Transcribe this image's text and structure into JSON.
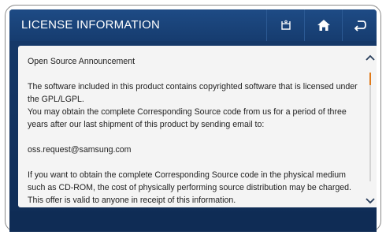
{
  "header": {
    "title": "LICENSE INFORMATION"
  },
  "icons": {
    "first": "washer-tub-icon",
    "home": "home-icon",
    "back": "back-icon",
    "scroll_up": "chevron-up-icon",
    "scroll_down": "chevron-down-icon"
  },
  "content": {
    "heading": "Open Source Announcement",
    "para1": "The software included in this product contains copyrighted software that is licensed under the GPL/LGPL.",
    "para2": "You may obtain the complete Corresponding Source code from us for a period of three years after our last shipment of this product by sending email to:",
    "email": "oss.request@samsung.com",
    "para3": "If you want to obtain the complete Corresponding Source code in the physical medium such as CD-ROM, the cost of physically performing source distribution may be charged.",
    "para4": "This offer is valid to anyone in receipt of this information."
  },
  "colors": {
    "header": "#1e4b85",
    "panel": "#f4f4f4",
    "scroll_thumb": "#e07a1a"
  }
}
